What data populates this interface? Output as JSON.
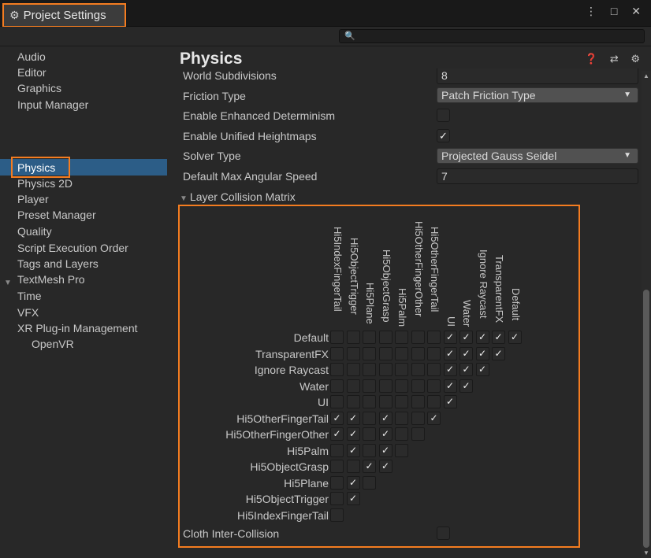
{
  "window": {
    "tab_title": "Project Settings",
    "controls": "⋮ □ ✕"
  },
  "search": {
    "placeholder": "🔍"
  },
  "sidebar": {
    "items": [
      {
        "label": "Audio"
      },
      {
        "label": "Editor"
      },
      {
        "label": "Graphics"
      },
      {
        "label": "Input Manager"
      },
      {
        "label": "Physics",
        "selected": true
      },
      {
        "label": "Physics 2D"
      },
      {
        "label": "Player"
      },
      {
        "label": "Preset Manager"
      },
      {
        "label": "Quality"
      },
      {
        "label": "Script Execution Order"
      },
      {
        "label": "Tags and Layers"
      },
      {
        "label": "TextMesh Pro"
      },
      {
        "label": "Time"
      },
      {
        "label": "VFX"
      },
      {
        "label": "XR Plug-in Management",
        "expanded": true
      },
      {
        "label": "OpenVR",
        "child": true
      }
    ]
  },
  "main": {
    "title": "Physics",
    "header_icons": "❓ ⇄ ⚙",
    "props": {
      "world_subdivisions": {
        "label": "World Subdivisions",
        "value": "8"
      },
      "friction_type": {
        "label": "Friction Type",
        "value": "Patch Friction Type"
      },
      "enhanced_determinism": {
        "label": "Enable Enhanced Determinism",
        "checked": false
      },
      "unified_heightmaps": {
        "label": "Enable Unified Heightmaps",
        "checked": true
      },
      "solver_type": {
        "label": "Solver Type",
        "value": "Projected Gauss Seidel"
      },
      "max_angular_speed": {
        "label": "Default Max Angular Speed",
        "value": "7"
      },
      "cloth_inter_collision": {
        "label": "Cloth Inter-Collision",
        "checked": false
      }
    },
    "foldout": "Layer Collision Matrix"
  },
  "matrix": {
    "columns": [
      "Hi5IndexFingerTail",
      "Hi5ObjectTrigger",
      "Hi5Plane",
      "Hi5ObjectGrasp",
      "Hi5Palm",
      "Hi5OtherFingerOther",
      "Hi5OtherFingerTail",
      "UI",
      "Water",
      "Ignore Raycast",
      "TransparentFX",
      "Default"
    ],
    "rows": [
      "Default",
      "TransparentFX",
      "Ignore Raycast",
      "Water",
      "UI",
      "Hi5OtherFingerTail",
      "Hi5OtherFingerOther",
      "Hi5Palm",
      "Hi5ObjectGrasp",
      "Hi5Plane",
      "Hi5ObjectTrigger",
      "Hi5IndexFingerTail"
    ],
    "checked": [
      [
        0,
        0,
        0,
        0,
        0,
        0,
        0,
        1,
        1,
        1,
        1,
        1
      ],
      [
        0,
        0,
        0,
        0,
        0,
        0,
        0,
        1,
        1,
        1,
        1
      ],
      [
        0,
        0,
        0,
        0,
        0,
        0,
        0,
        1,
        1,
        1
      ],
      [
        0,
        0,
        0,
        0,
        0,
        0,
        0,
        1,
        1
      ],
      [
        0,
        0,
        0,
        0,
        0,
        0,
        0,
        1
      ],
      [
        1,
        1,
        0,
        1,
        0,
        0,
        1
      ],
      [
        1,
        1,
        0,
        1,
        0,
        0
      ],
      [
        0,
        1,
        0,
        1,
        0
      ],
      [
        0,
        0,
        1,
        1
      ],
      [
        0,
        1,
        0
      ],
      [
        0,
        1
      ],
      [
        0
      ]
    ],
    "check_glyph": "✓"
  }
}
